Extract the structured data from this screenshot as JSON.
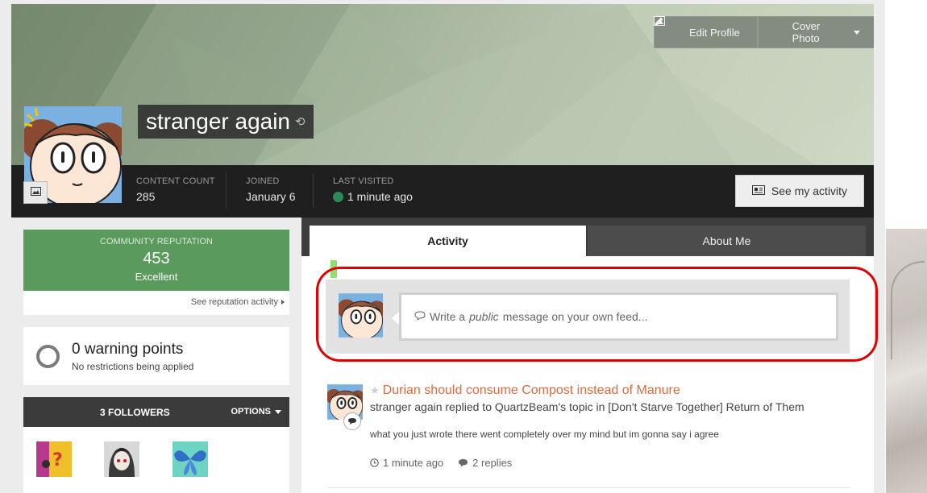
{
  "cover": {
    "edit_profile_label": "Edit Profile",
    "cover_photo_label": "Cover Photo"
  },
  "profile": {
    "name": "stranger again"
  },
  "stats": [
    {
      "label": "CONTENT COUNT",
      "value": "285"
    },
    {
      "label": "JOINED",
      "value": "January 6"
    },
    {
      "label": "LAST VISITED",
      "value": "1 minute ago"
    }
  ],
  "see_activity_label": "See my activity",
  "reputation": {
    "label": "COMMUNITY REPUTATION",
    "value": "453",
    "rating": "Excellent",
    "link": "See reputation activity"
  },
  "warnings": {
    "title": "0 warning points",
    "subtitle": "No restrictions being applied"
  },
  "followers": {
    "title": "3 FOLLOWERS",
    "options_label": "OPTIONS"
  },
  "tabs": [
    {
      "label": "Activity",
      "active": true
    },
    {
      "label": "About Me",
      "active": false
    }
  ],
  "composer": {
    "pre": "Write a",
    "em": "public",
    "post": "message on your own feed..."
  },
  "feed": [
    {
      "title": "Durian should consume Compost instead of Manure",
      "meta": "stranger again replied to QuartzBeam's topic in [Don't Starve Together] Return of Them",
      "body": "what you just wrote there went completely over my mind but im gonna say i agree",
      "time": "1 minute ago",
      "replies": "2 replies"
    }
  ],
  "colors": {
    "reputation_green": "#5a9a5d",
    "link_orange": "#e0693b",
    "online_green": "#2d8a57",
    "highlight_red": "#e00000"
  }
}
